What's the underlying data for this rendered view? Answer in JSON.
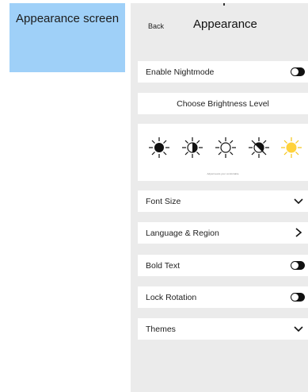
{
  "caption": "Appearance screen",
  "nav": {
    "back": "Back",
    "title": "Appearance"
  },
  "rows": {
    "nightmode": {
      "label": "Enable Nightmode",
      "toggle_on": true
    },
    "brightness_header": "Choose Brightness Level",
    "brightness_note": "Adjust levels your comfortable",
    "font_size": "Font Size",
    "language": "Language & Region",
    "bold": {
      "label": "Bold Text",
      "toggle_on": true
    },
    "lock": {
      "label": "Lock Rotation",
      "toggle_on": true
    },
    "themes": "Themes"
  },
  "brightness_icons": [
    "sun-full-icon",
    "sun-half-icon",
    "sun-empty-icon",
    "sun-slash-icon",
    "sun-bright-icon"
  ],
  "colors": {
    "caption_bg": "#9fd0f8",
    "panel_bg": "#ebebeb",
    "active_sun": "#ffd23c"
  }
}
